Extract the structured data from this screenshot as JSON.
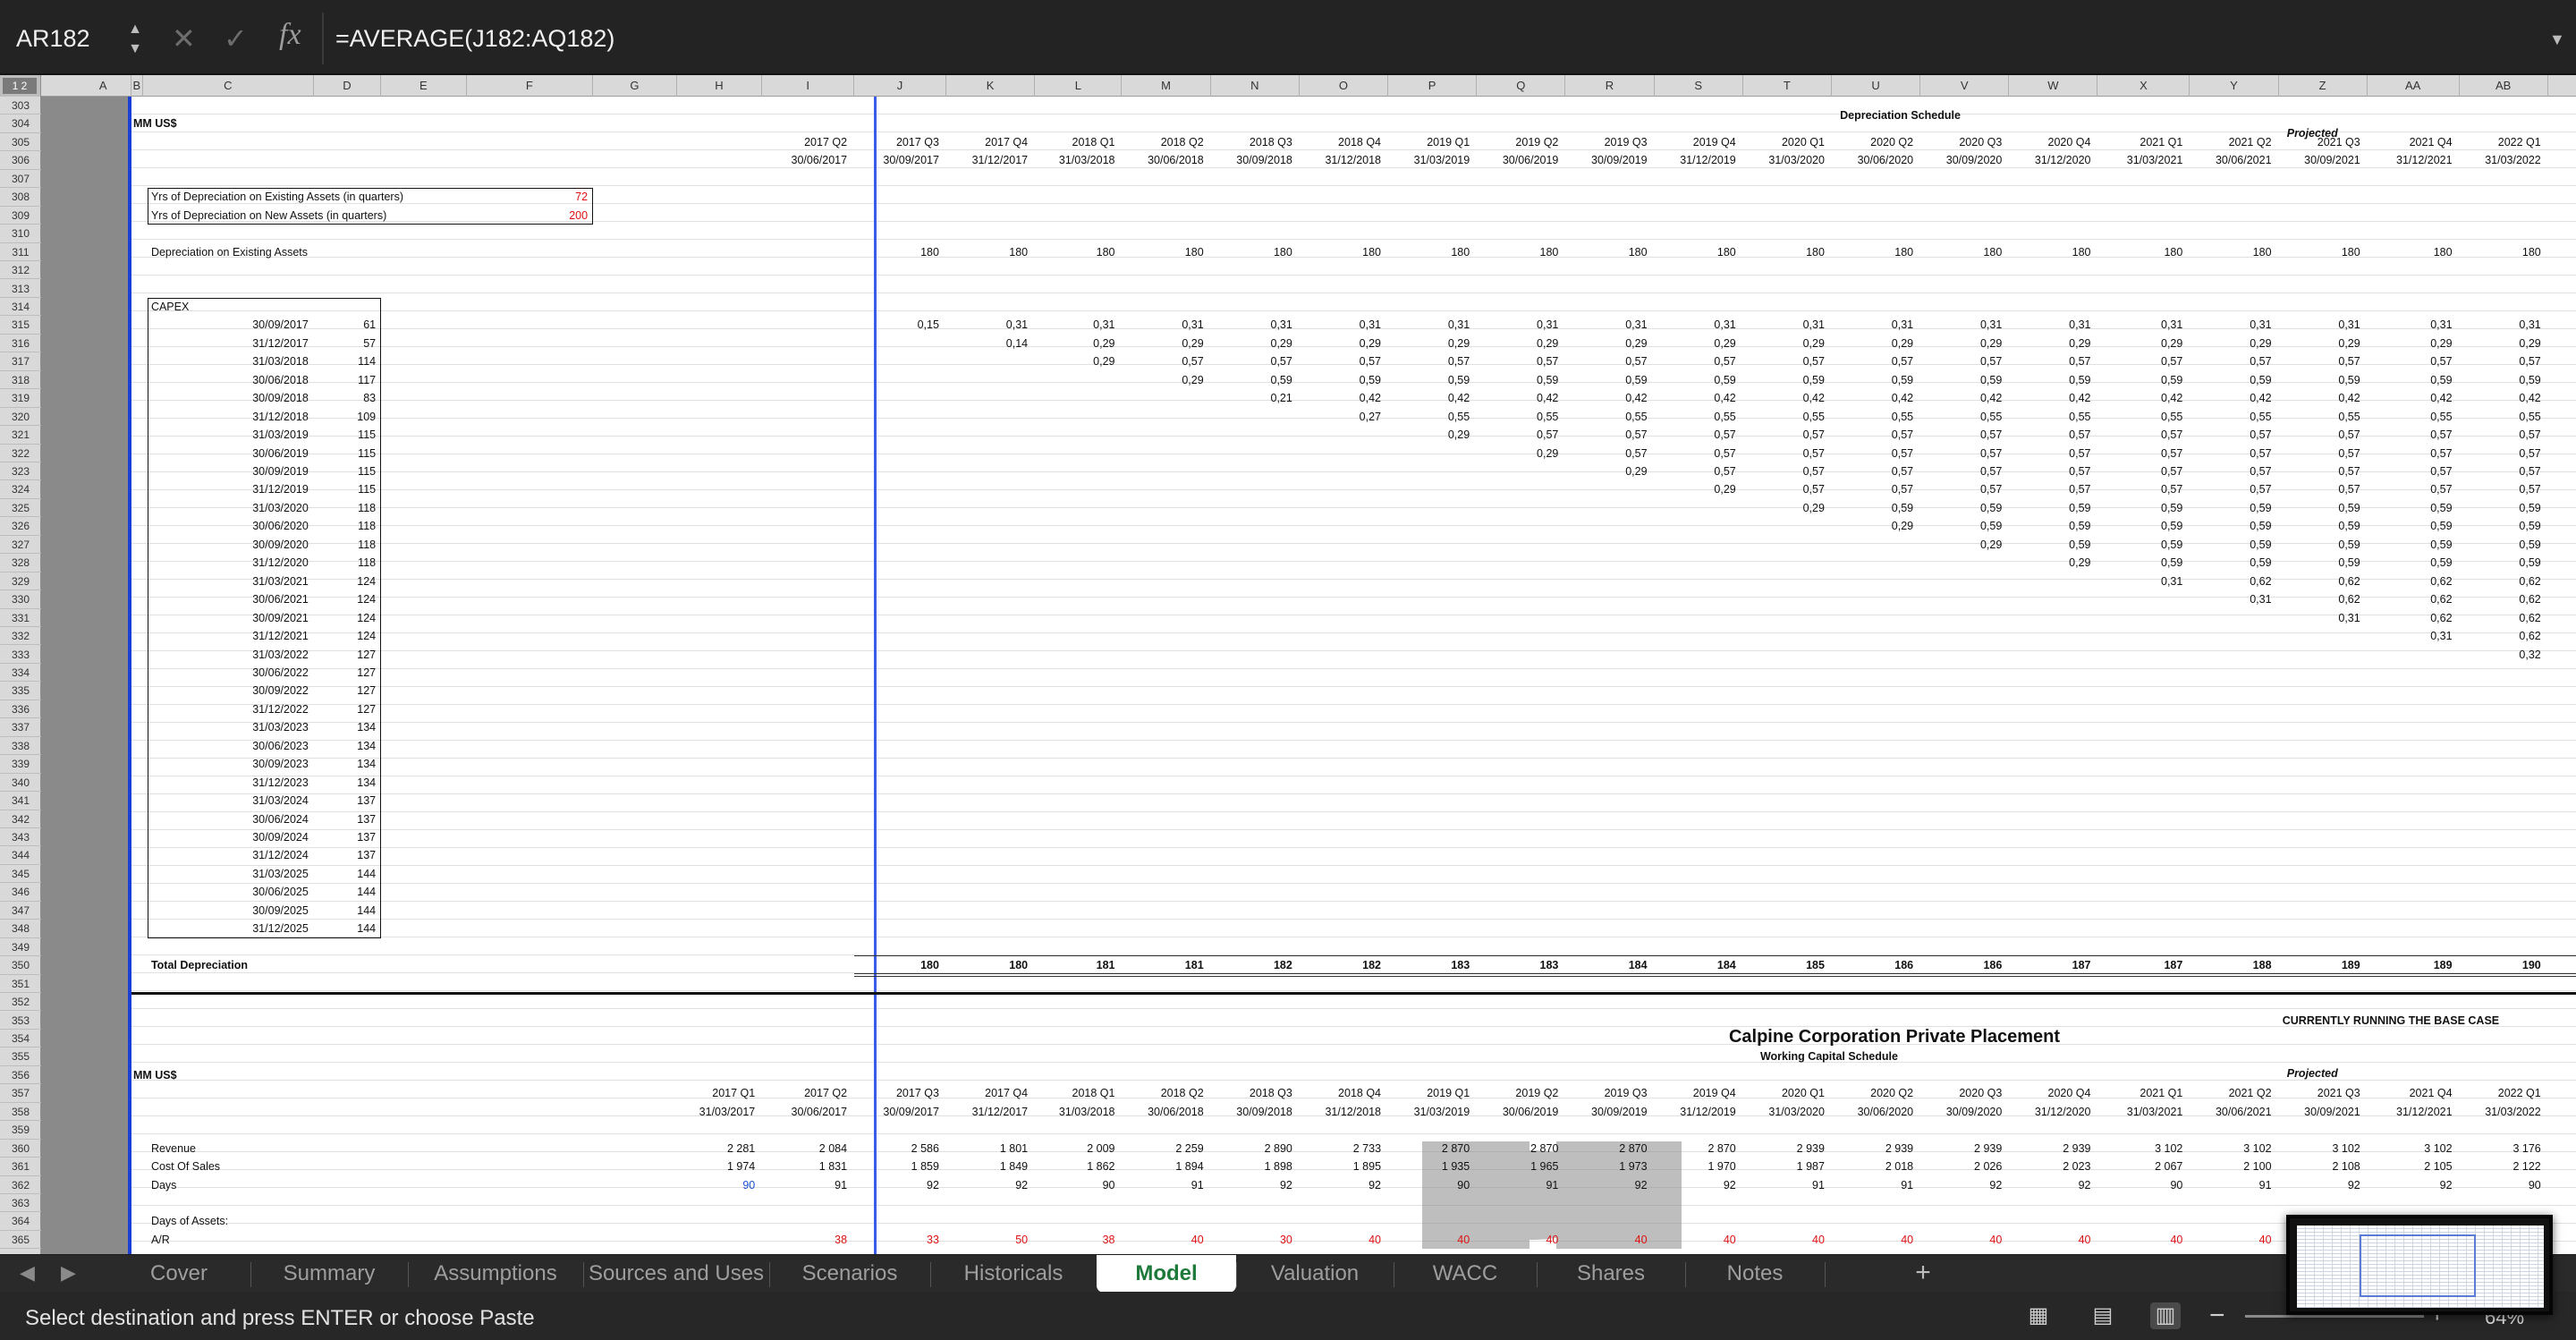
{
  "formula_bar": {
    "name_box": "AR182",
    "formula": "=AVERAGE(J182:AQ182)",
    "fx": "fx"
  },
  "columns": [
    "A",
    "B",
    "C",
    "D",
    "E",
    "F",
    "G",
    "H",
    "I",
    "J",
    "K",
    "L",
    "M",
    "N",
    "O",
    "P",
    "Q",
    "R",
    "S",
    "T",
    "U",
    "V",
    "W",
    "X",
    "Y",
    "Z",
    "AA",
    "AB"
  ],
  "outline_level": "1 2",
  "rows": [
    "303",
    "304",
    "305",
    "306",
    "307",
    "308",
    "309",
    "310",
    "311",
    "312",
    "313",
    "314",
    "315",
    "316",
    "317",
    "318",
    "319",
    "320",
    "321",
    "322",
    "323",
    "324",
    "325",
    "326",
    "327",
    "328",
    "329",
    "330",
    "331",
    "332",
    "333",
    "334",
    "335",
    "336",
    "337",
    "338",
    "339",
    "340",
    "341",
    "342",
    "343",
    "344",
    "345",
    "346",
    "347",
    "348",
    "349",
    "350",
    "351",
    "352",
    "353",
    "354",
    "355",
    "356",
    "357",
    "358",
    "359",
    "360",
    "361",
    "362",
    "363",
    "364",
    "365"
  ],
  "dep": {
    "title": "Depreciation Schedule",
    "units": "MM US$",
    "projected": "Projected",
    "quarters": [
      "2017 Q2",
      "2017 Q3",
      "2017 Q4",
      "2018 Q1",
      "2018 Q2",
      "2018 Q3",
      "2018 Q4",
      "2019 Q1",
      "2019 Q2",
      "2019 Q3",
      "2019 Q4",
      "2020 Q1",
      "2020 Q2",
      "2020 Q3",
      "2020 Q4",
      "2021 Q1",
      "2021 Q2",
      "2021 Q3",
      "2021 Q4",
      "2022 Q1"
    ],
    "dates": [
      "30/06/2017",
      "30/09/2017",
      "31/12/2017",
      "31/03/2018",
      "30/06/2018",
      "30/09/2018",
      "31/12/2018",
      "31/03/2019",
      "30/06/2019",
      "30/09/2019",
      "31/12/2019",
      "31/03/2020",
      "30/06/2020",
      "30/09/2020",
      "31/12/2020",
      "31/03/2021",
      "30/06/2021",
      "30/09/2021",
      "31/12/2021",
      "31/03/2022"
    ],
    "yrs_existing_label": "Yrs of Depreciation on Existing Assets (in quarters)",
    "yrs_existing": "72",
    "yrs_new_label": "Yrs of Depreciation on New Assets (in quarters)",
    "yrs_new": "200",
    "dep_existing_label": "Depreciation on Existing Assets",
    "dep_existing": [
      "180",
      "180",
      "180",
      "180",
      "180",
      "180",
      "180",
      "180",
      "180",
      "180",
      "180",
      "180",
      "180",
      "180",
      "180",
      "180",
      "180",
      "180",
      "180"
    ],
    "capex_label": "CAPEX",
    "capex": [
      [
        "30/09/2017",
        "61"
      ],
      [
        "31/12/2017",
        "57"
      ],
      [
        "31/03/2018",
        "114"
      ],
      [
        "30/06/2018",
        "117"
      ],
      [
        "30/09/2018",
        "83"
      ],
      [
        "31/12/2018",
        "109"
      ],
      [
        "31/03/2019",
        "115"
      ],
      [
        "30/06/2019",
        "115"
      ],
      [
        "30/09/2019",
        "115"
      ],
      [
        "31/12/2019",
        "115"
      ],
      [
        "31/03/2020",
        "118"
      ],
      [
        "30/06/2020",
        "118"
      ],
      [
        "30/09/2020",
        "118"
      ],
      [
        "31/12/2020",
        "118"
      ],
      [
        "31/03/2021",
        "124"
      ],
      [
        "30/06/2021",
        "124"
      ],
      [
        "30/09/2021",
        "124"
      ],
      [
        "31/12/2021",
        "124"
      ],
      [
        "31/03/2022",
        "127"
      ],
      [
        "30/06/2022",
        "127"
      ],
      [
        "30/09/2022",
        "127"
      ],
      [
        "31/12/2022",
        "127"
      ],
      [
        "31/03/2023",
        "134"
      ],
      [
        "30/06/2023",
        "134"
      ],
      [
        "30/09/2023",
        "134"
      ],
      [
        "31/12/2023",
        "134"
      ],
      [
        "31/03/2024",
        "137"
      ],
      [
        "30/06/2024",
        "137"
      ],
      [
        "30/09/2024",
        "137"
      ],
      [
        "31/12/2024",
        "137"
      ],
      [
        "31/03/2025",
        "144"
      ],
      [
        "30/06/2025",
        "144"
      ],
      [
        "30/09/2025",
        "144"
      ],
      [
        "31/12/2025",
        "144"
      ]
    ],
    "matrix": [
      [
        "0,15",
        "0,31",
        "0,31",
        "0,31",
        "0,31",
        "0,31",
        "0,31",
        "0,31",
        "0,31",
        "0,31",
        "0,31",
        "0,31",
        "0,31",
        "0,31",
        "0,31",
        "0,31",
        "0,31",
        "0,31",
        "0,31"
      ],
      [
        "",
        "0,14",
        "0,29",
        "0,29",
        "0,29",
        "0,29",
        "0,29",
        "0,29",
        "0,29",
        "0,29",
        "0,29",
        "0,29",
        "0,29",
        "0,29",
        "0,29",
        "0,29",
        "0,29",
        "0,29",
        "0,29"
      ],
      [
        "",
        "",
        "0,29",
        "0,57",
        "0,57",
        "0,57",
        "0,57",
        "0,57",
        "0,57",
        "0,57",
        "0,57",
        "0,57",
        "0,57",
        "0,57",
        "0,57",
        "0,57",
        "0,57",
        "0,57",
        "0,57"
      ],
      [
        "",
        "",
        "",
        "0,29",
        "0,59",
        "0,59",
        "0,59",
        "0,59",
        "0,59",
        "0,59",
        "0,59",
        "0,59",
        "0,59",
        "0,59",
        "0,59",
        "0,59",
        "0,59",
        "0,59",
        "0,59"
      ],
      [
        "",
        "",
        "",
        "",
        "0,21",
        "0,42",
        "0,42",
        "0,42",
        "0,42",
        "0,42",
        "0,42",
        "0,42",
        "0,42",
        "0,42",
        "0,42",
        "0,42",
        "0,42",
        "0,42",
        "0,42"
      ],
      [
        "",
        "",
        "",
        "",
        "",
        "0,27",
        "0,55",
        "0,55",
        "0,55",
        "0,55",
        "0,55",
        "0,55",
        "0,55",
        "0,55",
        "0,55",
        "0,55",
        "0,55",
        "0,55",
        "0,55"
      ],
      [
        "",
        "",
        "",
        "",
        "",
        "",
        "0,29",
        "0,57",
        "0,57",
        "0,57",
        "0,57",
        "0,57",
        "0,57",
        "0,57",
        "0,57",
        "0,57",
        "0,57",
        "0,57",
        "0,57"
      ],
      [
        "",
        "",
        "",
        "",
        "",
        "",
        "",
        "0,29",
        "0,57",
        "0,57",
        "0,57",
        "0,57",
        "0,57",
        "0,57",
        "0,57",
        "0,57",
        "0,57",
        "0,57",
        "0,57"
      ],
      [
        "",
        "",
        "",
        "",
        "",
        "",
        "",
        "",
        "0,29",
        "0,57",
        "0,57",
        "0,57",
        "0,57",
        "0,57",
        "0,57",
        "0,57",
        "0,57",
        "0,57",
        "0,57"
      ],
      [
        "",
        "",
        "",
        "",
        "",
        "",
        "",
        "",
        "",
        "0,29",
        "0,57",
        "0,57",
        "0,57",
        "0,57",
        "0,57",
        "0,57",
        "0,57",
        "0,57",
        "0,57"
      ],
      [
        "",
        "",
        "",
        "",
        "",
        "",
        "",
        "",
        "",
        "",
        "0,29",
        "0,59",
        "0,59",
        "0,59",
        "0,59",
        "0,59",
        "0,59",
        "0,59",
        "0,59"
      ],
      [
        "",
        "",
        "",
        "",
        "",
        "",
        "",
        "",
        "",
        "",
        "",
        "0,29",
        "0,59",
        "0,59",
        "0,59",
        "0,59",
        "0,59",
        "0,59",
        "0,59"
      ],
      [
        "",
        "",
        "",
        "",
        "",
        "",
        "",
        "",
        "",
        "",
        "",
        "",
        "0,29",
        "0,59",
        "0,59",
        "0,59",
        "0,59",
        "0,59",
        "0,59"
      ],
      [
        "",
        "",
        "",
        "",
        "",
        "",
        "",
        "",
        "",
        "",
        "",
        "",
        "",
        "0,29",
        "0,59",
        "0,59",
        "0,59",
        "0,59",
        "0,59"
      ],
      [
        "",
        "",
        "",
        "",
        "",
        "",
        "",
        "",
        "",
        "",
        "",
        "",
        "",
        "",
        "0,31",
        "0,62",
        "0,62",
        "0,62",
        "0,62"
      ],
      [
        "",
        "",
        "",
        "",
        "",
        "",
        "",
        "",
        "",
        "",
        "",
        "",
        "",
        "",
        "",
        "0,31",
        "0,62",
        "0,62",
        "0,62"
      ],
      [
        "",
        "",
        "",
        "",
        "",
        "",
        "",
        "",
        "",
        "",
        "",
        "",
        "",
        "",
        "",
        "",
        "0,31",
        "0,62",
        "0,62"
      ],
      [
        "",
        "",
        "",
        "",
        "",
        "",
        "",
        "",
        "",
        "",
        "",
        "",
        "",
        "",
        "",
        "",
        "",
        "0,31",
        "0,62"
      ],
      [
        "",
        "",
        "",
        "",
        "",
        "",
        "",
        "",
        "",
        "",
        "",
        "",
        "",
        "",
        "",
        "",
        "",
        "",
        "0,32"
      ]
    ],
    "total_label": "Total Depreciation",
    "total": [
      "180",
      "180",
      "181",
      "181",
      "182",
      "182",
      "183",
      "183",
      "184",
      "184",
      "185",
      "186",
      "186",
      "187",
      "187",
      "188",
      "189",
      "189",
      "190"
    ]
  },
  "wc": {
    "banner": "CURRENTLY RUNNING THE BASE CASE",
    "company": "Calpine Corporation Private Placement",
    "title": "Working Capital Schedule",
    "units": "MM US$",
    "projected": "Projected",
    "quarters": [
      "2017 Q1",
      "2017 Q2",
      "2017 Q3",
      "2017 Q4",
      "2018 Q1",
      "2018 Q2",
      "2018 Q3",
      "2018 Q4",
      "2019 Q1",
      "2019 Q2",
      "2019 Q3",
      "2019 Q4",
      "2020 Q1",
      "2020 Q2",
      "2020 Q3",
      "2020 Q4",
      "2021 Q1",
      "2021 Q2",
      "2021 Q3",
      "2021 Q4",
      "2022 Q1"
    ],
    "dates": [
      "31/03/2017",
      "30/06/2017",
      "30/09/2017",
      "31/12/2017",
      "31/03/2018",
      "30/06/2018",
      "30/09/2018",
      "31/12/2018",
      "31/03/2019",
      "30/06/2019",
      "30/09/2019",
      "31/12/2019",
      "31/03/2020",
      "30/06/2020",
      "30/09/2020",
      "31/12/2020",
      "31/03/2021",
      "30/06/2021",
      "30/09/2021",
      "31/12/2021",
      "31/03/2022"
    ],
    "revenue_label": "Revenue",
    "revenue": [
      "2 281",
      "2 084",
      "2 586",
      "1 801",
      "2 009",
      "2 259",
      "2 890",
      "2 733",
      "2 870",
      "2 870",
      "2 870",
      "2 870",
      "2 939",
      "2 939",
      "2 939",
      "2 939",
      "3 102",
      "3 102",
      "3 102",
      "3 102",
      "3 176"
    ],
    "cos_label": "Cost Of Sales",
    "cos": [
      "1 974",
      "1 831",
      "1 859",
      "1 849",
      "1 862",
      "1 894",
      "1 898",
      "1 895",
      "1 935",
      "1 965",
      "1 973",
      "1 970",
      "1 987",
      "2 018",
      "2 026",
      "2 023",
      "2 067",
      "2 100",
      "2 108",
      "2 105",
      "2 122"
    ],
    "days_label": "Days",
    "days": [
      "90",
      "91",
      "92",
      "92",
      "90",
      "91",
      "92",
      "92",
      "90",
      "91",
      "92",
      "92",
      "91",
      "91",
      "92",
      "92",
      "90",
      "91",
      "92",
      "92",
      "90"
    ],
    "doa_label": "Days of Assets:",
    "ar_label": "A/R",
    "ar": [
      "",
      "38",
      "33",
      "50",
      "38",
      "40",
      "30",
      "40",
      "40",
      "40",
      "40",
      "40",
      "40",
      "40",
      "40",
      "40",
      "40",
      "40",
      "",
      "",
      ""
    ]
  },
  "tabs": [
    "Cover",
    "Summary",
    "Assumptions",
    "Sources and Uses",
    "Scenarios",
    "Historicals",
    "Model",
    "Valuation",
    "WACC",
    "Shares",
    "Notes"
  ],
  "active_tab": "Model",
  "status": {
    "message": "Select destination and press ENTER or choose Paste",
    "zoom": "64%"
  }
}
